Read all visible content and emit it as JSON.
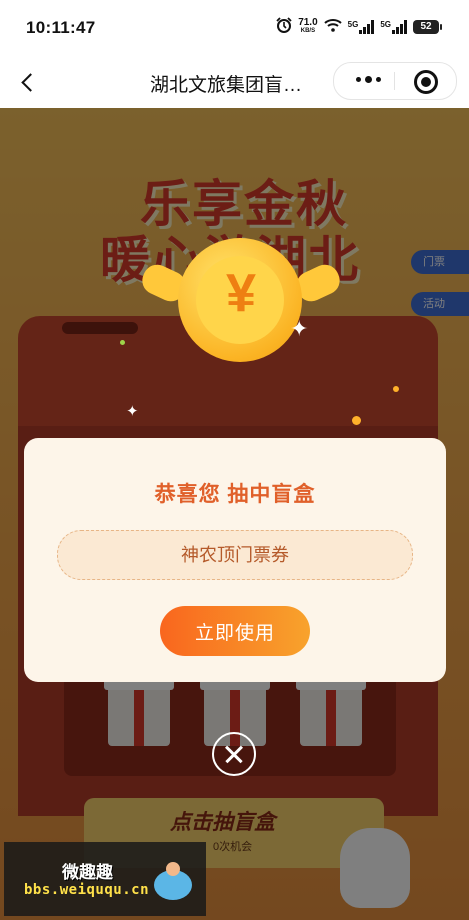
{
  "status_bar": {
    "time": "10:11:47",
    "net_speed_value": "71.0",
    "net_speed_unit": "KB/S",
    "sig1_label": "5G",
    "sig2_label": "5G",
    "battery": "52"
  },
  "nav": {
    "title": "湖北文旅集团盲…"
  },
  "background": {
    "headline_line1": "乐享金秋",
    "headline_line2": "暖心游湖北",
    "side_tab_1": "门票",
    "side_tab_2": "活动",
    "coin_symbol": "¥",
    "draw_button": "点击抽盲盒",
    "chances": "0次机会"
  },
  "modal": {
    "title": "恭喜您 抽中盲盒",
    "prize": "神农顶门票券",
    "use_button": "立即使用"
  },
  "watermark": {
    "line1": "微趣趣",
    "line2": "bbs.weiququ.cn"
  },
  "colors": {
    "accent_orange": "#f9661e",
    "title_orange": "#e0602a",
    "modal_bg": "#fdf5e9"
  }
}
